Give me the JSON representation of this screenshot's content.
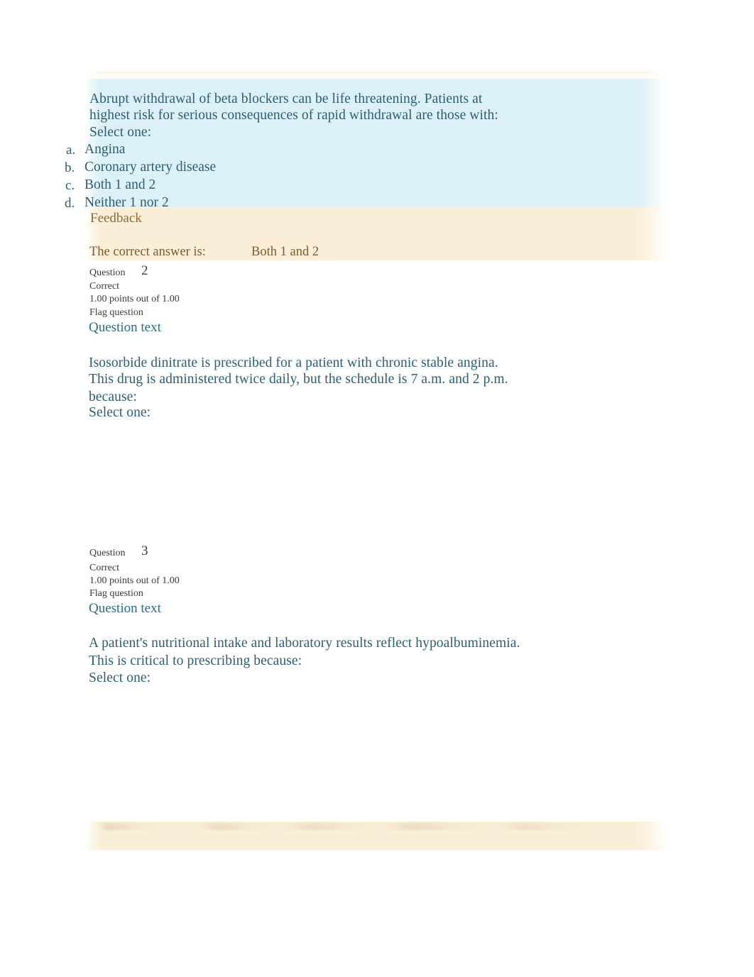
{
  "page": {
    "background_color": "#ffffff",
    "question_text_color": "#2e5c73",
    "feedback_text_color": "#8a6a3a",
    "highlight_blue": "#dcf0f7",
    "highlight_beige": "#faeed8"
  },
  "question1": {
    "stem_line1": "Abrupt withdrawal of beta blockers can be life threatening. Patients at",
    "stem_line2": "highest risk for serious consequences of rapid withdrawal are those with:",
    "select_one": "Select one:",
    "options": [
      {
        "marker": "a.",
        "label": "Angina"
      },
      {
        "marker": "b.",
        "label": "Coronary artery disease"
      },
      {
        "marker": "c.",
        "label": "Both 1 and 2"
      },
      {
        "marker": "d.",
        "label": "Neither 1 nor 2"
      }
    ],
    "feedback_heading": "Feedback",
    "correct_answer_label": "The correct answer is:",
    "correct_answer_value": "Both 1 and 2"
  },
  "question2": {
    "question_word": "Question",
    "number": "2",
    "status": "Correct",
    "points": "1.00 points out of 1.00",
    "flag": "Flag question",
    "question_text_heading": "Question text",
    "stem_line1": "Isosorbide dinitrate is prescribed for a patient with chronic stable angina.",
    "stem_line2": "This drug is administered twice daily, but the schedule is 7 a.m. and 2 p.m.",
    "stem_line3": "because:",
    "select_one": "Select one:"
  },
  "question3": {
    "question_word": "Question",
    "number": "3",
    "status": "Correct",
    "points": "1.00 points out of 1.00",
    "flag": "Flag question",
    "question_text_heading": "Question text",
    "stem_line1": "A patient's nutritional intake and laboratory results reflect hypoalbuminemia.",
    "stem_line2": "This is critical to prescribing because:",
    "select_one": "Select one:"
  }
}
